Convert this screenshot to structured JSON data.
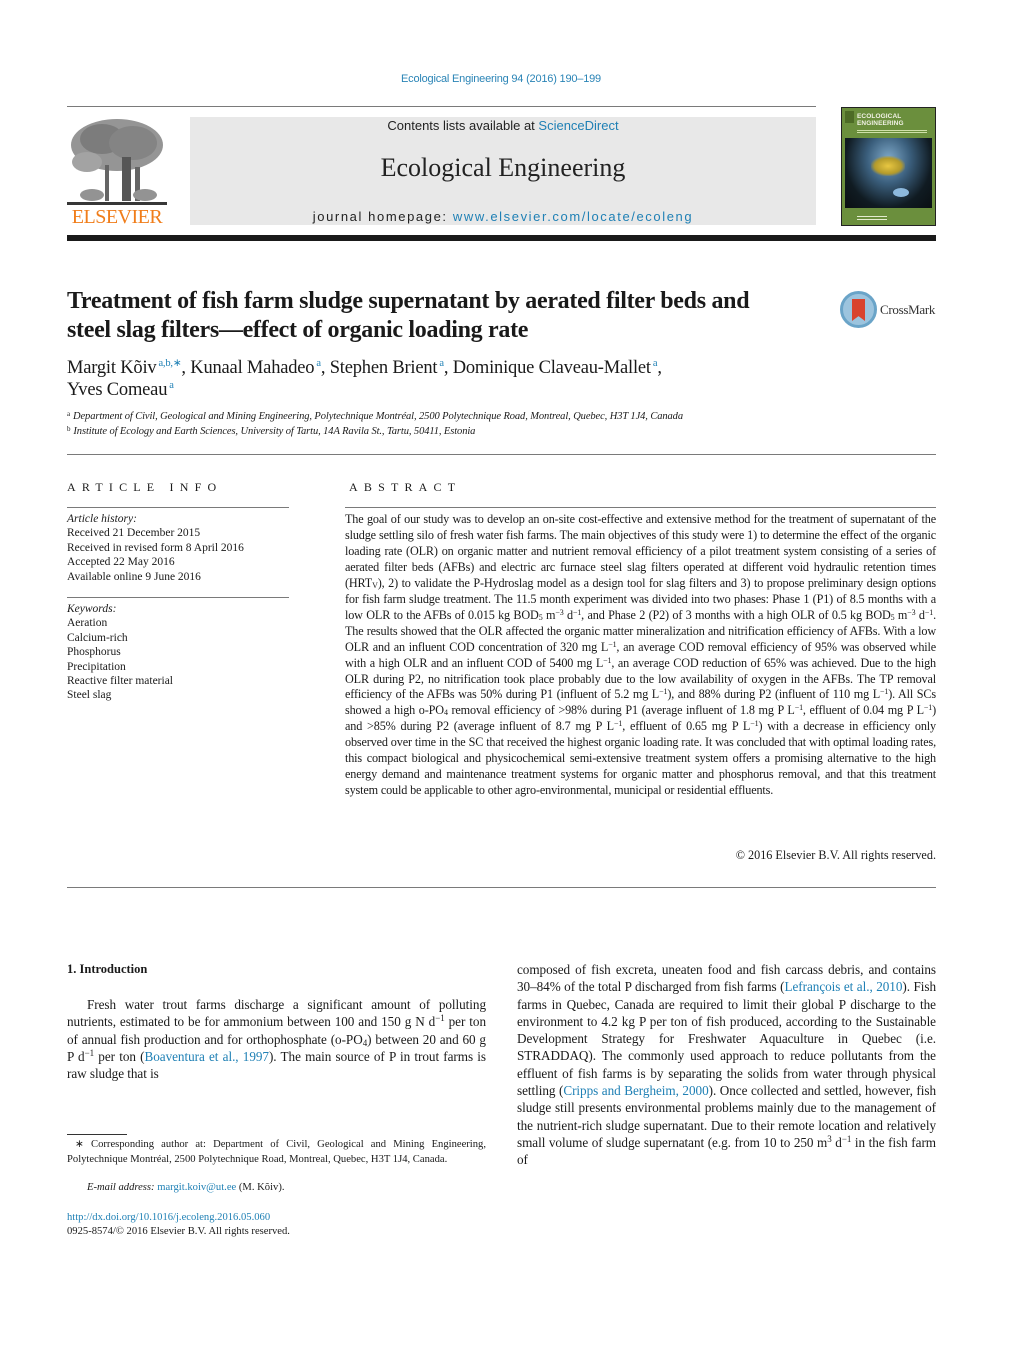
{
  "header": {
    "journal_ref": "Ecological Engineering 94 (2016) 190–199",
    "contents_prefix": "Contents lists available at ",
    "contents_link": "ScienceDirect",
    "journal_name": "Ecological Engineering",
    "homepage_prefix": "journal homepage: ",
    "homepage_link": "www.elsevier.com/locate/ecoleng",
    "publisher_logo_text": "ELSEVIER",
    "cover_title_line1": "ECOLOGICAL",
    "cover_title_line2": "ENGINEERING",
    "brand_orange": "#f07d1a",
    "link_blue": "#1f80b5"
  },
  "article": {
    "title_line1": "Treatment of fish farm sludge supernatant by aerated filter beds and",
    "title_line2": "steel slag filters—effect of organic loading rate",
    "crossmark_label": "CrossMark",
    "authors": [
      {
        "name": "Margit Kõiv",
        "marks": "a,b,∗",
        "sep": ", "
      },
      {
        "name": "Kunaal Mahadeo",
        "marks": "a",
        "sep": ", "
      },
      {
        "name": "Stephen Brient",
        "marks": "a",
        "sep": ", "
      },
      {
        "name": "Dominique Claveau-Mallet",
        "marks": "a",
        "sep": ","
      },
      {
        "name": "Yves Comeau",
        "marks": "a",
        "sep": ""
      }
    ],
    "affiliations": [
      {
        "mark": "a",
        "text": "Department of Civil, Geological and Mining Engineering, Polytechnique Montréal, 2500 Polytechnique Road, Montreal, Quebec, H3T 1J4, Canada"
      },
      {
        "mark": "b",
        "text": "Institute of Ecology and Earth Sciences, University of Tartu, 14A Ravila St., Tartu, 50411, Estonia"
      }
    ]
  },
  "article_info": {
    "heading": "ARTICLE INFO",
    "history_label": "Article history:",
    "history": [
      "Received 21 December 2015",
      "Received in revised form 8 April 2016",
      "Accepted 22 May 2016",
      "Available online 9 June 2016"
    ],
    "keywords_label": "Keywords:",
    "keywords": [
      "Aeration",
      "Calcium-rich",
      "Phosphorus",
      "Precipitation",
      "Reactive filter material",
      "Steel slag"
    ]
  },
  "abstract": {
    "heading": "ABSTRACT",
    "p1": "The goal of our study was to develop an on-site cost-effective and extensive method for the treatment of supernatant of the sludge settling silo of fresh water fish farms. The main objectives of this study were 1) to determine the effect of the organic loading rate (OLR) on organic matter and nutrient removal efficiency of a pilot treatment system consisting of a series of aerated filter beds (AFBs) and electric arc furnace steel slag filters operated at different void hydraulic retention times (HRT",
    "hrt_sub": "V",
    "p2": "), 2) to validate the P-Hydroslag model as a design tool for slag filters and 3) to propose preliminary design options for fish farm sludge treatment. The 11.5 month experiment was divided into two phases: Phase 1 (P1) of 8.5 months with a low OLR to the AFBs of 0.015 kg BOD",
    "bod_sub": "5",
    "unit_m": " m",
    "exp_m3": "−3",
    "unit_d": " d",
    "exp_m1": "−1",
    "p3": ", and Phase 2 (P2) of 3 months with a high OLR of 0.5 kg BOD",
    "p4": ". The results showed that the OLR affected the organic matter mineralization and nitrification efficiency of AFBs. With a low OLR and an influent COD concentration of 320 mg L",
    "p5": ", an average COD removal efficiency of 95% was observed while with a high OLR and an influent COD of 5400 mg L",
    "p6": ", an average COD reduction of 65% was achieved. Due to the high OLR during P2, no nitrification took place probably due to the low availability of oxygen in the AFBs. The TP removal efficiency of the AFBs was 50% during P1 (influent of 5.2 mg L",
    "p7": "), and 88% during P2 (influent of 110 mg L",
    "p8": "). All SCs showed a high o-PO",
    "po4_sub": "4",
    "p9": " removal efficiency of >98% during P1 (average influent of 1.8 mg P L",
    "p10": ", effluent of 0.04 mg P L",
    "p11": ") and >85% during P2 (average influent of 8.7 mg P L",
    "p12": ", effluent of 0.65 mg P L",
    "p13": ") with a decrease in efficiency only observed over time in the SC that received the highest organic loading rate. It was concluded that with optimal loading rates, this compact biological and physicochemical semi-extensive treatment system offers a promising alternative to the high energy demand and maintenance treatment systems for organic matter and phosphorus removal, and that this treatment system could be applicable to other agro-environmental, municipal or residential effluents.",
    "copyright": "© 2016 Elsevier B.V. All rights reserved."
  },
  "introduction": {
    "heading": "1.  Introduction",
    "left_a": "Fresh water trout farms discharge a significant amount of polluting nutrients, estimated to be for ammonium between 100 and 150 g N d",
    "exp_m1": "−1",
    "left_b": " per ton of annual fish production and for orthophosphate (o-PO",
    "po4_sub": "4",
    "left_c": ") between 20 and 60 g P d",
    "left_d": " per ton (",
    "cite1": "Boaventura et al., 1997",
    "left_e": "). The main source of P in trout farms is raw sludge that is",
    "right_a": "composed of fish excreta, uneaten food and fish carcass debris, and contains 30–84% of the total P discharged from fish farms (",
    "cite2": "Lefrançois et al., 2010",
    "right_b": "). Fish farms in Quebec, Canada are required to limit their global P discharge to the environment to 4.2 kg P per ton of fish produced, according to the Sustainable Development Strategy for Freshwater Aquaculture in Quebec (i.e. STRADDAQ). The commonly used approach to reduce pollutants from the effluent of fish farms is by separating the solids from water through physical settling (",
    "cite3": "Cripps and Bergheim, 2000",
    "right_c": "). Once collected and settled, however, fish sludge still presents environmental problems mainly due to the management of the nutrient-rich sludge supernatant. Due to their remote location and relatively small volume of sludge supernatant (e.g. from 10 to 250 m",
    "exp_3": "3",
    "right_d": " d",
    "right_e": " in the fish farm of"
  },
  "footnotes": {
    "corresponding": "∗  Corresponding author at: Department of Civil, Geological and Mining Engineering, Polytechnique Montréal, 2500 Polytechnique Road, Montreal, Quebec, H3T 1J4, Canada.",
    "email_label": "E-mail address: ",
    "email": "margit.koiv@ut.ee",
    "email_suffix": " (M. Kõiv).",
    "doi": "http://dx.doi.org/10.1016/j.ecoleng.2016.05.060",
    "issn": "0925-8574/© 2016 Elsevier B.V. All rights reserved."
  }
}
